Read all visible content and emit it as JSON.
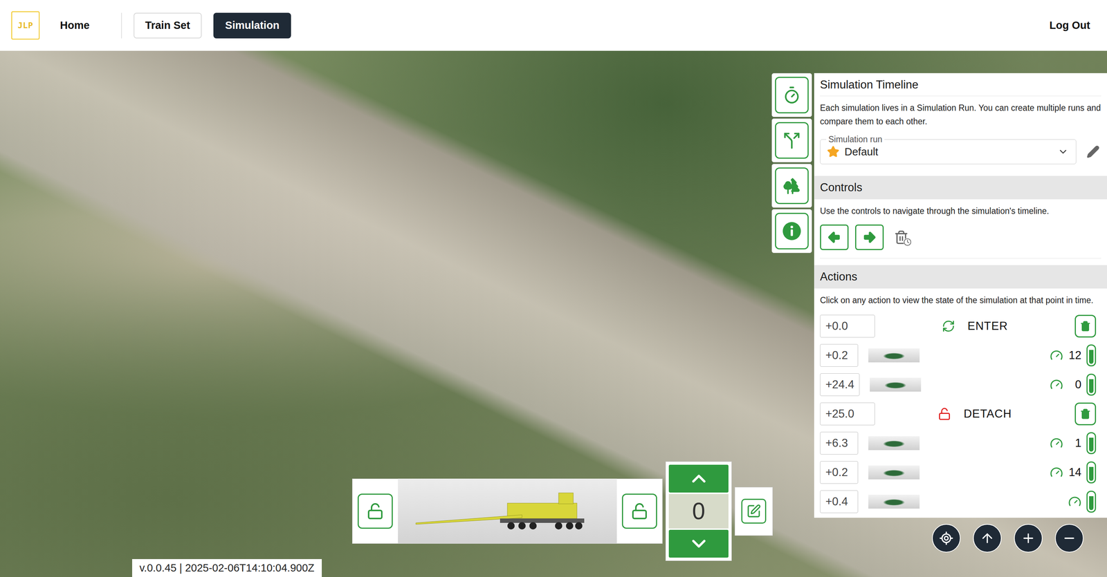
{
  "nav": {
    "logo": "JLP",
    "links": [
      {
        "label": "Home",
        "kind": "link",
        "selected": false
      },
      {
        "label": "Train Set",
        "kind": "button",
        "selected": false
      },
      {
        "label": "Simulation",
        "kind": "button",
        "selected": true
      }
    ],
    "logout": "Log Out"
  },
  "panel": {
    "title": "Simulation Timeline",
    "description": "Each simulation lives in a Simulation Run. You can create multiple runs and compare them to each other.",
    "run": {
      "label": "Simulation run",
      "value": "Default"
    },
    "controls": {
      "title": "Controls",
      "description": "Use the controls to navigate through the simulation's timeline."
    },
    "actions": {
      "title": "Actions",
      "description": "Click on any action to view the state of the simulation at that point in time.",
      "items": [
        {
          "time": "+0.0",
          "kind": "enter",
          "label": "ENTER",
          "color": "#2f9a3e"
        },
        {
          "time": "+0.2",
          "kind": "speed",
          "value": "12"
        },
        {
          "time": "+24.4",
          "kind": "speed",
          "value": "0"
        },
        {
          "time": "+25.0",
          "kind": "detach",
          "label": "DETACH",
          "color": "#e02424"
        },
        {
          "time": "+6.3",
          "kind": "speed",
          "value": "1"
        },
        {
          "time": "+0.2",
          "kind": "speed",
          "value": "14"
        },
        {
          "time": "+0.4",
          "kind": "speed"
        }
      ]
    }
  },
  "vehicle": {
    "count": "0"
  },
  "version": "v.0.0.45 | 2025-02-06T14:10:04.900Z"
}
